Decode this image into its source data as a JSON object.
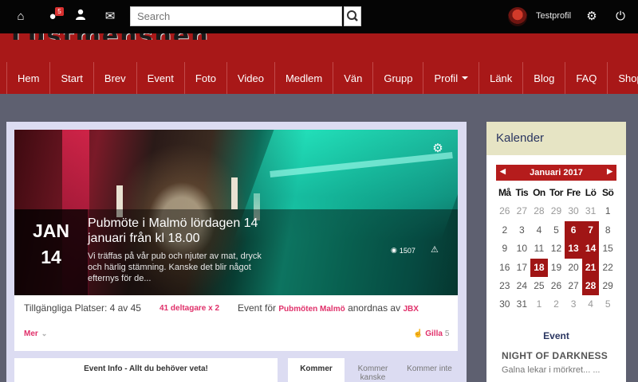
{
  "topbar": {
    "notification_count": "5",
    "search_placeholder": "Search",
    "username": "Testprofil"
  },
  "header": {
    "logo_text": "Lustmenshen"
  },
  "nav": {
    "items": [
      "Hem",
      "Start",
      "Brev",
      "Event",
      "Foto",
      "Video",
      "Medlem",
      "Vän",
      "Grupp",
      "Profil",
      "Länk",
      "Blog",
      "FAQ",
      "Shop"
    ]
  },
  "event": {
    "month": "JAN",
    "day": "14",
    "title": "Pubmöte i Malmö lördagen 14 januari från kl 18.00",
    "description": "Vi träffas på vår pub och njuter av mat, dryck och härlig stämning. Kanske det blir något efternys för de...",
    "views": "1507",
    "places_text": "Tillgängliga Platser: 4 av 45",
    "participants_text": "41 deltagare x 2",
    "event_for_prefix": "Event för",
    "event_for_group": "Pubmöten Malmö",
    "organized_by_text": "anordnas av",
    "organizer": "JBX",
    "more_label": "Mer",
    "like_label": "Gilla",
    "like_count": "5"
  },
  "info_box": {
    "title": "Event Info - Allt du behöver veta!"
  },
  "tabs": [
    {
      "label": "Kommer",
      "active": true
    },
    {
      "label": "Kommer kanske",
      "active": false
    },
    {
      "label": "Kommer inte",
      "active": false
    }
  ],
  "calendar": {
    "heading": "Kalender",
    "month_title": "Januari 2017",
    "weekdays": [
      "Må",
      "Tis",
      "On",
      "Tor",
      "Fre",
      "Lö",
      "Sö"
    ],
    "weeks": [
      [
        {
          "d": "26",
          "m": true
        },
        {
          "d": "27",
          "m": true
        },
        {
          "d": "28",
          "m": true
        },
        {
          "d": "29",
          "m": true
        },
        {
          "d": "30",
          "m": true
        },
        {
          "d": "31",
          "m": true
        },
        {
          "d": "1"
        }
      ],
      [
        {
          "d": "2"
        },
        {
          "d": "3"
        },
        {
          "d": "4"
        },
        {
          "d": "5"
        },
        {
          "d": "6",
          "e": true
        },
        {
          "d": "7",
          "e": true
        },
        {
          "d": "8"
        }
      ],
      [
        {
          "d": "9"
        },
        {
          "d": "10"
        },
        {
          "d": "11"
        },
        {
          "d": "12"
        },
        {
          "d": "13",
          "e": true
        },
        {
          "d": "14",
          "e": true
        },
        {
          "d": "15"
        }
      ],
      [
        {
          "d": "16"
        },
        {
          "d": "17"
        },
        {
          "d": "18",
          "e": true
        },
        {
          "d": "19"
        },
        {
          "d": "20"
        },
        {
          "d": "21",
          "e": true
        },
        {
          "d": "22"
        }
      ],
      [
        {
          "d": "23"
        },
        {
          "d": "24"
        },
        {
          "d": "25"
        },
        {
          "d": "26"
        },
        {
          "d": "27"
        },
        {
          "d": "28",
          "e": true
        },
        {
          "d": "29"
        }
      ],
      [
        {
          "d": "30"
        },
        {
          "d": "31"
        },
        {
          "d": "1",
          "m": true
        },
        {
          "d": "2",
          "m": true
        },
        {
          "d": "3",
          "m": true
        },
        {
          "d": "4",
          "m": true
        },
        {
          "d": "5",
          "m": true
        }
      ]
    ],
    "event_label": "Event",
    "event_name": "NIGHT OF DARKNESS",
    "event_desc": "Galna lekar i mörkret... ..."
  },
  "colors": {
    "header_red": "#a81818",
    "accent_pink": "#e0306a",
    "calendar_event": "#a01515"
  }
}
